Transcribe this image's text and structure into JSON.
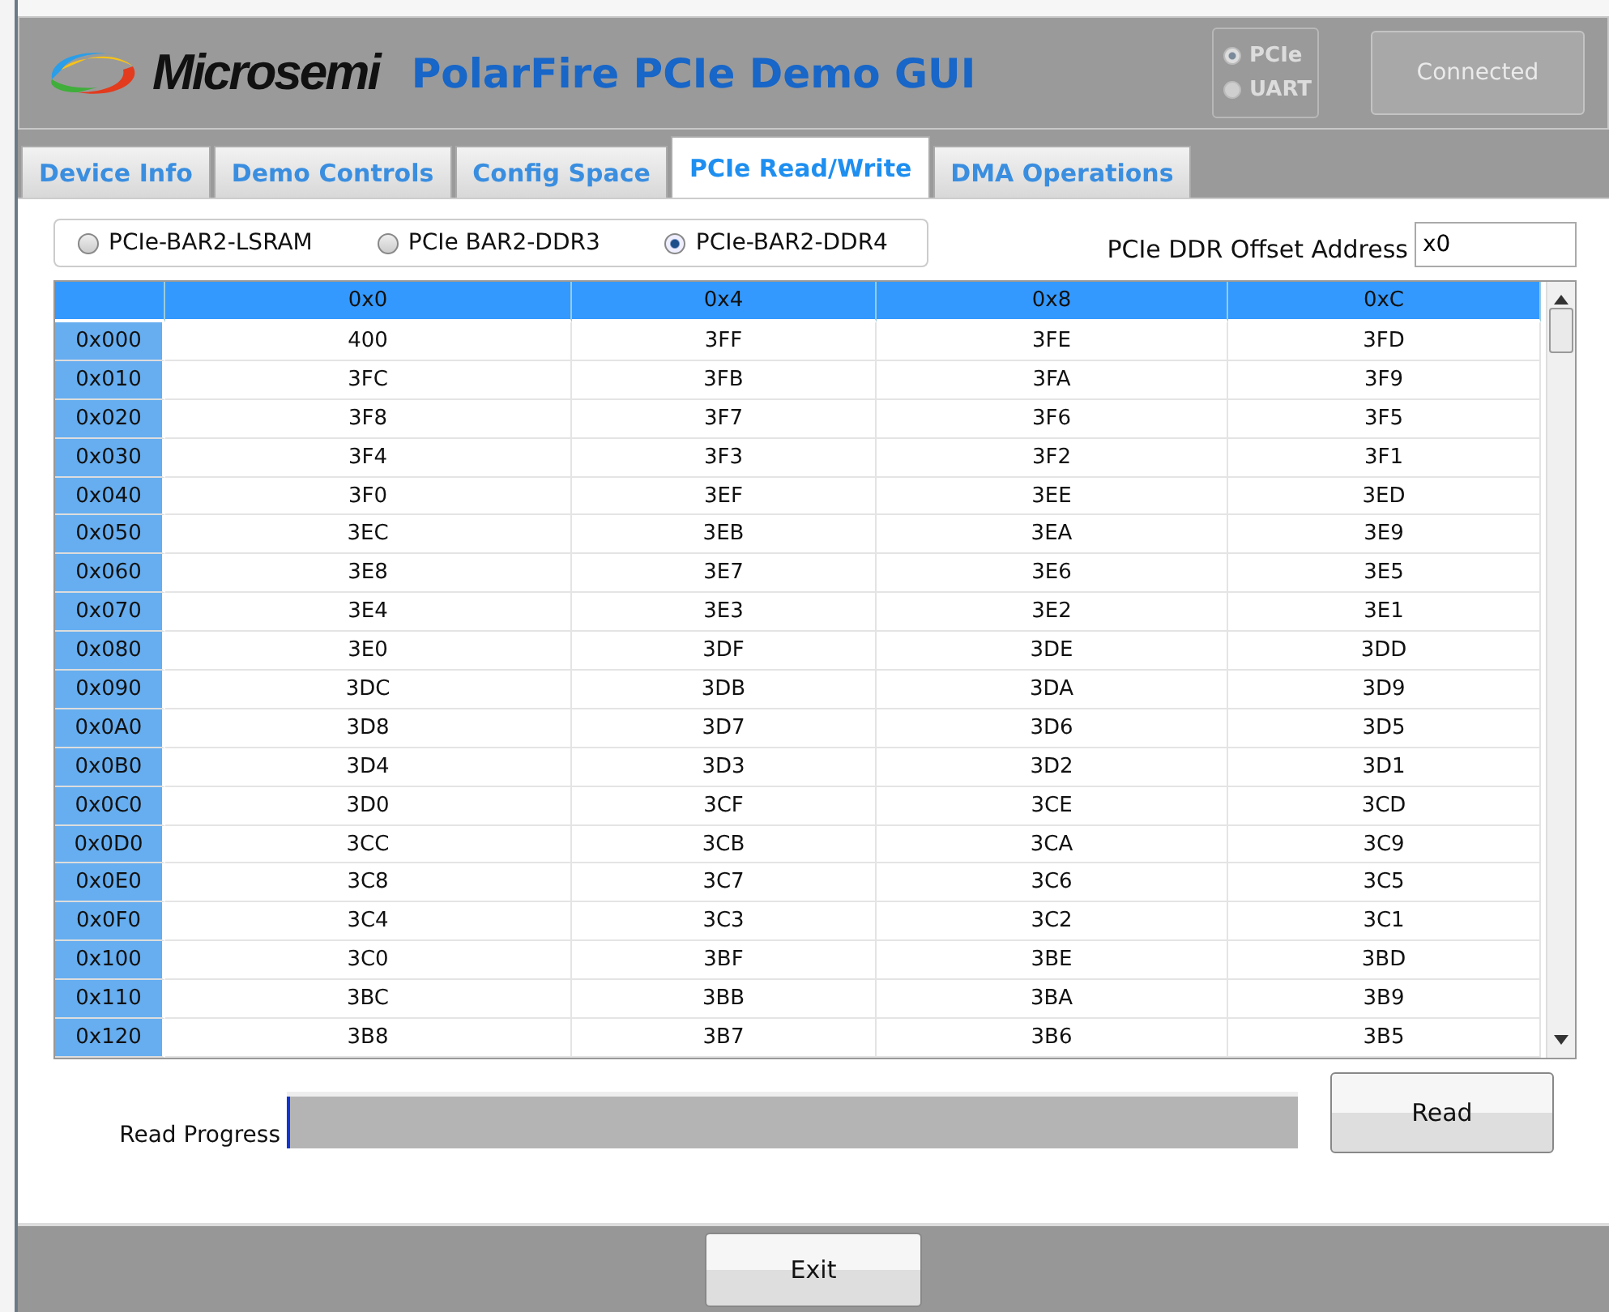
{
  "brand": "Microsemi",
  "title": "PolarFire PCIe Demo GUI",
  "interface": [
    {
      "label": "PCIe",
      "selected": true
    },
    {
      "label": "UART",
      "selected": false
    }
  ],
  "status_button": {
    "label": "Connected",
    "disabled": true
  },
  "tabs": [
    {
      "label": "Device Info",
      "selected": false
    },
    {
      "label": "Demo Controls",
      "selected": false
    },
    {
      "label": "Config Space",
      "selected": false
    },
    {
      "label": "PCIe Read/Write",
      "selected": true
    },
    {
      "label": "DMA Operations",
      "selected": false
    }
  ],
  "regions": [
    {
      "label": "PCIe-BAR2-LSRAM",
      "selected": false
    },
    {
      "label": "PCIe BAR2-DDR3",
      "selected": false
    },
    {
      "label": "PCIe-BAR2-DDR4",
      "selected": true
    }
  ],
  "offset": {
    "label": "PCIe DDR Offset Address",
    "value": "x0"
  },
  "table": {
    "columns": [
      "0x0",
      "0x4",
      "0x8",
      "0xC"
    ],
    "rows": [
      {
        "address": "0x000",
        "cells": [
          "400",
          "3FF",
          "3FE",
          "3FD"
        ]
      },
      {
        "address": "0x010",
        "cells": [
          "3FC",
          "3FB",
          "3FA",
          "3F9"
        ]
      },
      {
        "address": "0x020",
        "cells": [
          "3F8",
          "3F7",
          "3F6",
          "3F5"
        ]
      },
      {
        "address": "0x030",
        "cells": [
          "3F4",
          "3F3",
          "3F2",
          "3F1"
        ]
      },
      {
        "address": "0x040",
        "cells": [
          "3F0",
          "3EF",
          "3EE",
          "3ED"
        ]
      },
      {
        "address": "0x050",
        "cells": [
          "3EC",
          "3EB",
          "3EA",
          "3E9"
        ]
      },
      {
        "address": "0x060",
        "cells": [
          "3E8",
          "3E7",
          "3E6",
          "3E5"
        ]
      },
      {
        "address": "0x070",
        "cells": [
          "3E4",
          "3E3",
          "3E2",
          "3E1"
        ]
      },
      {
        "address": "0x080",
        "cells": [
          "3E0",
          "3DF",
          "3DE",
          "3DD"
        ]
      },
      {
        "address": "0x090",
        "cells": [
          "3DC",
          "3DB",
          "3DA",
          "3D9"
        ]
      },
      {
        "address": "0x0A0",
        "cells": [
          "3D8",
          "3D7",
          "3D6",
          "3D5"
        ]
      },
      {
        "address": "0x0B0",
        "cells": [
          "3D4",
          "3D3",
          "3D2",
          "3D1"
        ]
      },
      {
        "address": "0x0C0",
        "cells": [
          "3D0",
          "3CF",
          "3CE",
          "3CD"
        ]
      },
      {
        "address": "0x0D0",
        "cells": [
          "3CC",
          "3CB",
          "3CA",
          "3C9"
        ]
      },
      {
        "address": "0x0E0",
        "cells": [
          "3C8",
          "3C7",
          "3C6",
          "3C5"
        ]
      },
      {
        "address": "0x0F0",
        "cells": [
          "3C4",
          "3C3",
          "3C2",
          "3C1"
        ]
      },
      {
        "address": "0x100",
        "cells": [
          "3C0",
          "3BF",
          "3BE",
          "3BD"
        ]
      },
      {
        "address": "0x110",
        "cells": [
          "3BC",
          "3BB",
          "3BA",
          "3B9"
        ]
      },
      {
        "address": "0x120",
        "cells": [
          "3B8",
          "3B7",
          "3B6",
          "3B5"
        ]
      }
    ]
  },
  "progress": {
    "label": "Read Progress",
    "level": 0.003
  },
  "read_button": "Read",
  "exit_button": "Exit"
}
